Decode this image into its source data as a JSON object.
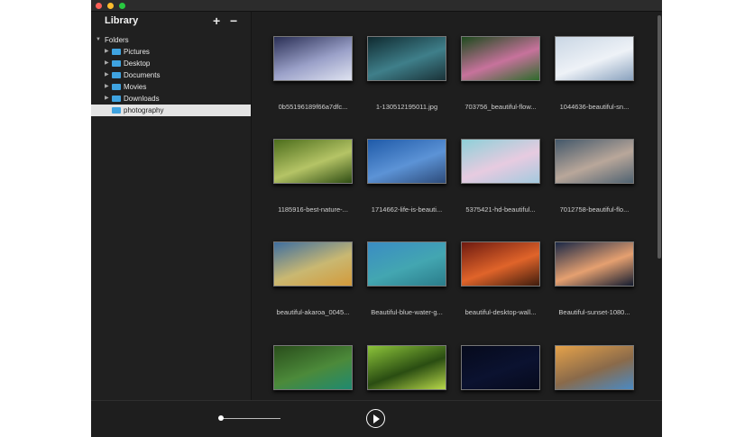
{
  "sidebar": {
    "title": "Library",
    "add_label": "+",
    "remove_label": "−",
    "root": "Folders",
    "folders": [
      "Pictures",
      "Desktop",
      "Documents",
      "Movies",
      "Downloads",
      "photography"
    ],
    "selected": "photography"
  },
  "images": [
    {
      "name": "0b55196189f66a7dfc...",
      "colors": [
        "#2a2f55",
        "#9aa0c8",
        "#dfe3f0"
      ]
    },
    {
      "name": "1-130512195011.jpg",
      "colors": [
        "#0f2a30",
        "#3f7f8a",
        "#1a3238"
      ]
    },
    {
      "name": "703756_beautiful-flow...",
      "colors": [
        "#1d4a1d",
        "#c7729c",
        "#2d6b2b"
      ]
    },
    {
      "name": "1044636-beautiful-sn...",
      "colors": [
        "#c9d6e4",
        "#eef2f7",
        "#8aa2be"
      ]
    },
    {
      "name": "1185916-best-nature-...",
      "colors": [
        "#4c6d1c",
        "#b5c466",
        "#2f4d14"
      ]
    },
    {
      "name": "1714662-life-is-beauti...",
      "colors": [
        "#1f5aa8",
        "#5c93d6",
        "#2d4b7a"
      ]
    },
    {
      "name": "5375421-hd-beautiful...",
      "colors": [
        "#8ed0d8",
        "#e7cbe0",
        "#a3c9de"
      ]
    },
    {
      "name": "7012758-beautiful-flo...",
      "colors": [
        "#43586a",
        "#b9a79a",
        "#4f6271"
      ]
    },
    {
      "name": "beautiful-akaroa_0045...",
      "colors": [
        "#3e6ea0",
        "#c9b872",
        "#d39a3a"
      ]
    },
    {
      "name": "Beautiful-blue-water-g...",
      "colors": [
        "#3a8cc4",
        "#43a6b1",
        "#2a7c8a"
      ]
    },
    {
      "name": "beautiful-desktop-wall...",
      "colors": [
        "#6e1a10",
        "#e0642a",
        "#3e1c0d"
      ]
    },
    {
      "name": "Beautiful-sunset-1080...",
      "colors": [
        "#1a2846",
        "#e5a070",
        "#131c30"
      ]
    },
    {
      "name": "",
      "colors": [
        "#294d1b",
        "#4c8a3a",
        "#1f8a70"
      ]
    },
    {
      "name": "",
      "colors": [
        "#8cc43a",
        "#2a4d12",
        "#b8d84a"
      ]
    },
    {
      "name": "",
      "colors": [
        "#060a1c",
        "#0b1230",
        "#060a1c"
      ]
    },
    {
      "name": "",
      "colors": [
        "#e5a24a",
        "#8a6a4a",
        "#4a8ac4"
      ]
    }
  ],
  "accent": "#3fa3e0"
}
